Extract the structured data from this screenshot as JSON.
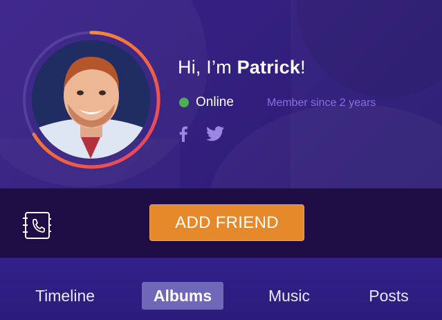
{
  "profile": {
    "greeting_prefix": "Hi, I’m ",
    "name": "Patrick",
    "greeting_suffix": "!",
    "status": "Online",
    "member_since": "Member since 2 years"
  },
  "actions": {
    "add_friend": "ADD FRIEND"
  },
  "tabs": [
    {
      "label": "Timeline",
      "active": false
    },
    {
      "label": "Albums",
      "active": true
    },
    {
      "label": "Music",
      "active": false
    },
    {
      "label": "Posts",
      "active": false
    }
  ],
  "colors": {
    "accent": "#e5892a",
    "online": "#4caf50",
    "hero_bg": "#33207f",
    "action_bar_bg": "#1e0d45",
    "active_tab": "#6f68b8",
    "ring_start": "#f7a92a",
    "ring_end": "#e53a6b"
  },
  "icons": {
    "facebook": "facebook-icon",
    "twitter": "twitter-icon",
    "contacts": "contact-book-icon"
  }
}
